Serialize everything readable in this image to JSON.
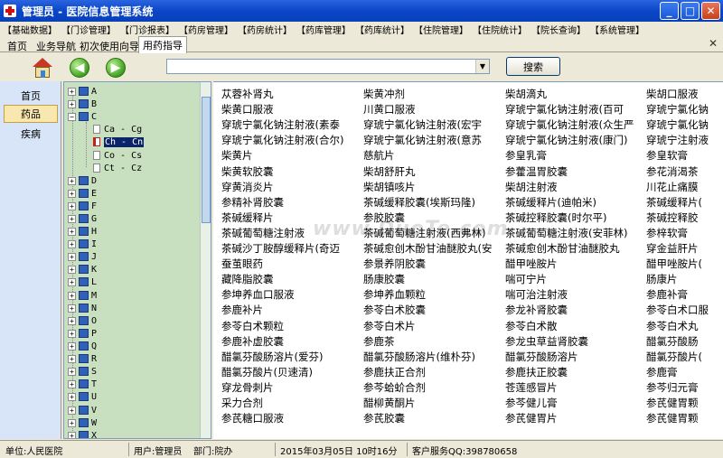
{
  "window": {
    "title": "管理员 - 医院信息管理系统",
    "minimize_icon": "minimize-icon",
    "maximize_icon": "maximize-icon",
    "close_icon": "close-icon"
  },
  "menubar": [
    "【基础数据】",
    "【门诊管理】",
    "【门诊报表】",
    "【药房管理】",
    "【药房统计】",
    "【药库管理】",
    "【药库统计】",
    "【住院管理】",
    "【住院统计】",
    "【院长查询】",
    "【系统管理】"
  ],
  "tabs": [
    "首页",
    "业务导航",
    "初次使用向导",
    "用药指导"
  ],
  "active_tab": "用药指导",
  "toolbar": {
    "search_value": "",
    "search_button": "搜索"
  },
  "leftnav": [
    "首页",
    "药品",
    "疾病"
  ],
  "leftnav_active": "药品",
  "tree": {
    "letters_top": [
      "A",
      "B",
      "C"
    ],
    "c_children": [
      "Ca - Cg",
      "Ch - Cn",
      "Co - Cs",
      "Ct - Cz"
    ],
    "selected": "Ch - Cn",
    "letters_bottom": [
      "D",
      "E",
      "F",
      "G",
      "H",
      "I",
      "J",
      "K",
      "L",
      "M",
      "N",
      "O",
      "P",
      "Q",
      "R",
      "S",
      "T",
      "U",
      "V",
      "W",
      "X"
    ]
  },
  "drugs": [
    [
      "苁蓉补肾丸",
      "柴黄冲剂",
      "柴胡滴丸",
      "柴胡口服液"
    ],
    [
      "柴黄口服液",
      "川黄口服液",
      "穿琥宁氯化钠注射液(百可",
      "穿琥宁氯化钠"
    ],
    [
      "穿琥宁氯化钠注射液(素泰",
      "穿琥宁氯化钠注射液(宏宇",
      "穿琥宁氯化钠注射液(众生严",
      "穿琥宁氯化钠"
    ],
    [
      "穿琥宁氯化钠注射液(合尔)",
      "穿琥宁氯化钠注射液(意苏",
      "穿琥宁氯化钠注射液(康门)",
      "穿琥宁注射液"
    ],
    [
      "柴黄片",
      "慈航片",
      "参皇乳膏",
      "参皇软膏"
    ],
    [
      "柴黄软胶囊",
      "柴胡舒肝丸",
      "参藿温胃胶囊",
      "参花消渴茶"
    ],
    [
      "穿黄消炎片",
      "柴胡镇咳片",
      "柴胡注射液",
      "川花止痛膜"
    ],
    [
      "参精补肾胶囊",
      "茶碱缓释胶囊(埃斯玛隆)",
      "茶碱缓释片(迪帕米)",
      "茶碱缓释片("
    ],
    [
      "茶碱缓释片",
      "参胶胶囊",
      "茶碱控释胶囊(时尔平)",
      "茶碱控释胶"
    ],
    [
      "茶碱葡萄糖注射液",
      "茶碱葡萄糖注射液(西弗林)",
      "茶碱葡萄糖注射液(安菲林)",
      "参梓软膏"
    ],
    [
      "茶碱沙丁胺醇缓释片(奇迈",
      "茶碱愈创木酚甘油醚胶丸(安",
      "茶碱愈创木酚甘油醚胶丸",
      "穿金益肝片"
    ],
    [
      "蚕茧眼药",
      "参景养阴胶囊",
      "醋甲唑胺片",
      "醋甲唑胺片("
    ],
    [
      "藏降脂胶囊",
      "肠康胶囊",
      "喘可宁片",
      "肠康片"
    ],
    [
      "参坤养血口服液",
      "参坤养血颗粒",
      "喘可治注射液",
      "参鹿补膏"
    ],
    [
      "参鹿补片",
      "参苓白术胶囊",
      "参龙补肾胶囊",
      "参苓白术口服"
    ],
    [
      "参苓白术颗粒",
      "参苓白术片",
      "参苓白术散",
      "参苓白术丸"
    ],
    [
      "参鹿补虚胶囊",
      "参鹿茶",
      "参龙虫草益肾胶囊",
      "醋氯芬酸肠"
    ],
    [
      "醋氯芬酸肠溶片(爱芬)",
      "醋氯芬酸肠溶片(维朴芬)",
      "醋氯芬酸肠溶片",
      "醋氯芬酸片("
    ],
    [
      "醋氯芬酸片(贝速清)",
      "参鹿扶正合剂",
      "参鹿扶正胶囊",
      "参鹿膏"
    ],
    [
      "穿龙骨刺片",
      "参芩蛤蚧合剂",
      "苍莲感冒片",
      "参芩归元膏"
    ],
    [
      "采力合剂",
      "醋柳黄酮片",
      "参芩健儿膏",
      "参芪健胃颗"
    ],
    [
      "参芪糖口服液",
      "参芪胶囊",
      "参芪健胃片",
      "参芪健胃颗"
    ]
  ],
  "watermark": "www.DuoTe.com",
  "status": {
    "unit": "单位:人民医院",
    "user": "用户:管理员",
    "dept": "部门:院办",
    "datetime": "2015年03月05日 10时16分",
    "service": "客户服务QQ:398780658"
  }
}
